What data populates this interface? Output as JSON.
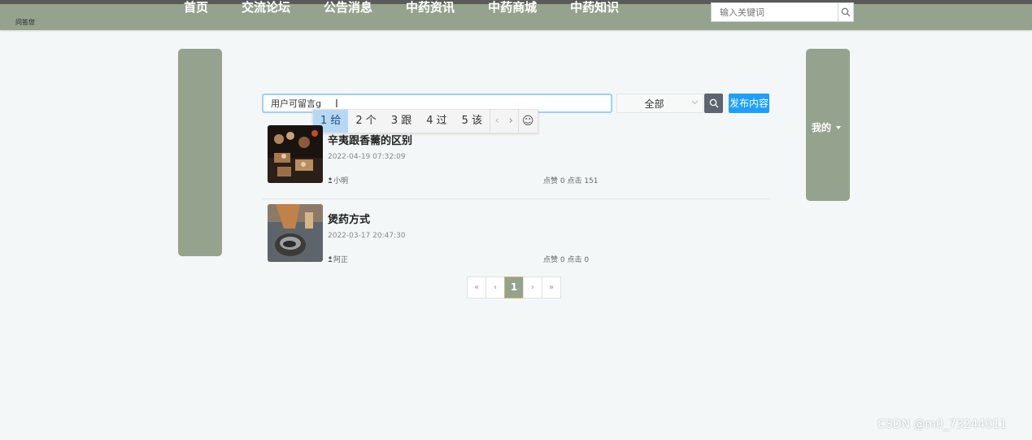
{
  "header": {
    "site_tag": "问答您",
    "nav": [
      "首页",
      "交流论坛",
      "公告消息",
      "中药资讯",
      "中药商城",
      "中药知识"
    ],
    "search_placeholder": "输入关键词"
  },
  "forum": {
    "search_value": "用户可留言g",
    "ime": {
      "candidates": [
        "1 给",
        "2 个",
        "3 跟",
        "4 过",
        "5 该"
      ],
      "active_index": 0
    },
    "type_select_value": "全部",
    "publish_label": "发布内容"
  },
  "posts": [
    {
      "title": "辛夷跟香薷的区别",
      "time": "2022-04-19 07:32:09",
      "author": "小明",
      "likes_label": "点赞 0",
      "clicks_label": "点击 151"
    },
    {
      "title": "煲药方式",
      "time": "2022-03-17 20:47:30",
      "author": "阿正",
      "likes_label": "点赞 0",
      "clicks_label": "点击 0"
    }
  ],
  "pagination": {
    "first": "«",
    "prev": "‹",
    "current": "1",
    "next": "›",
    "last": "»"
  },
  "sidebar_right": {
    "menu_label": "我的"
  },
  "watermark": "CSDN @m0_73244011",
  "colors": {
    "theme": "#95a28d",
    "primary_button": "#1e9fff",
    "search_button": "#5f6570",
    "page_background": "#f3f7f7"
  },
  "icons": [
    "search-icon",
    "user-icon",
    "chevron-down-icon",
    "emoji-icon",
    "chevron-left-icon",
    "chevron-right-icon"
  ]
}
